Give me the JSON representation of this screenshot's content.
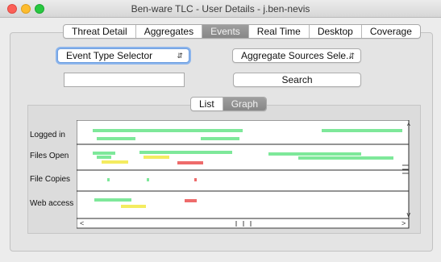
{
  "window": {
    "title": "Ben-ware TLC - User Details - j.ben-nevis"
  },
  "tabs": [
    {
      "label": "Threat Detail",
      "active": false
    },
    {
      "label": "Aggregates",
      "active": false
    },
    {
      "label": "Events",
      "active": true
    },
    {
      "label": "Real Time",
      "active": false
    },
    {
      "label": "Desktop",
      "active": false
    },
    {
      "label": "Coverage",
      "active": false
    }
  ],
  "controls": {
    "event_type_selector": "Event Type Selector",
    "aggregate_sources_selector": "Aggregate Sources Sele...",
    "search_input_value": "",
    "search_button": "Search"
  },
  "view_toggle": [
    {
      "label": "List",
      "active": false
    },
    {
      "label": "Graph",
      "active": true
    }
  ],
  "graph": {
    "rows": [
      "Logged in",
      "Files Open",
      "File Copies",
      "Web access"
    ],
    "colors": {
      "green": "#7ee89a",
      "yellow": "#f4ec60",
      "red": "#ee6b6b"
    }
  }
}
